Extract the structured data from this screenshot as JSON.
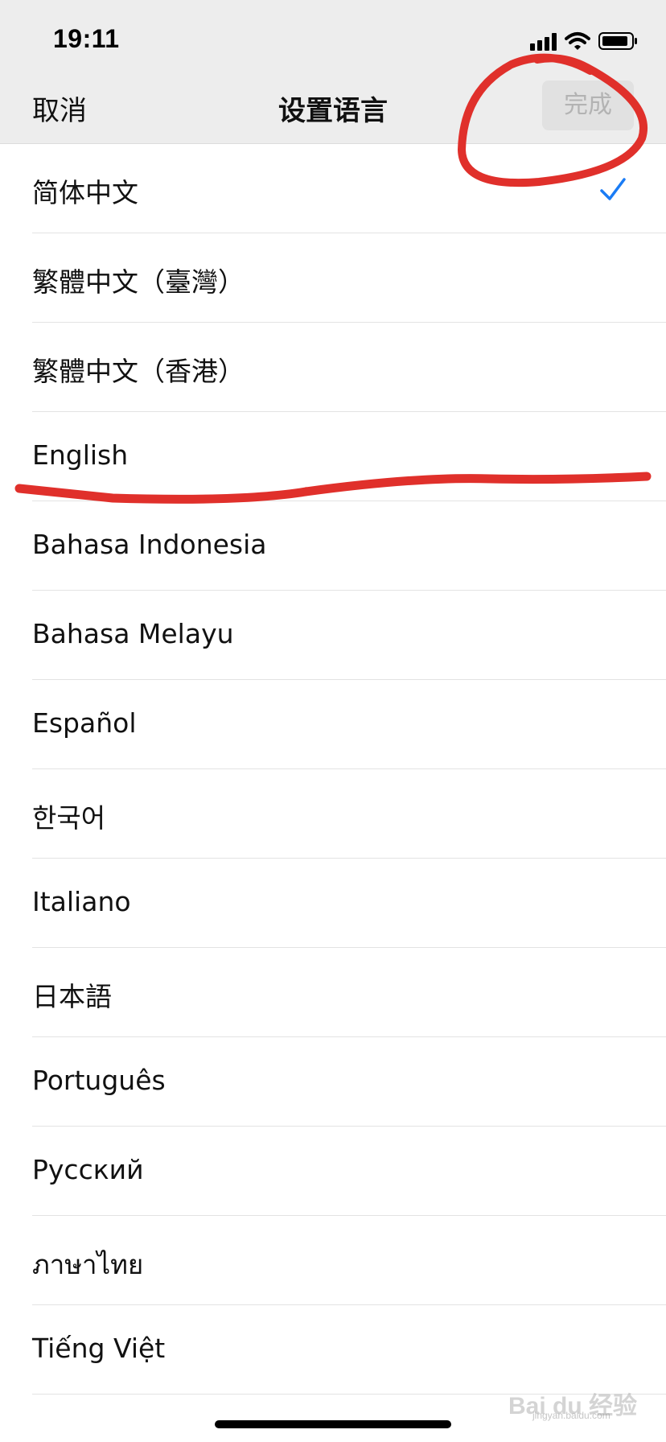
{
  "status_bar": {
    "time": "19:11",
    "icons": [
      "signal-icon",
      "wifi-icon",
      "battery-icon"
    ]
  },
  "nav": {
    "cancel_label": "取消",
    "title": "设置语言",
    "done_label": "完成",
    "done_enabled": false
  },
  "languages": [
    {
      "label": "简体中文",
      "selected": true
    },
    {
      "label": "繁體中文（臺灣）",
      "selected": false
    },
    {
      "label": "繁體中文（香港）",
      "selected": false
    },
    {
      "label": "English",
      "selected": false
    },
    {
      "label": "Bahasa Indonesia",
      "selected": false
    },
    {
      "label": "Bahasa Melayu",
      "selected": false
    },
    {
      "label": "Español",
      "selected": false
    },
    {
      "label": "한국어",
      "selected": false
    },
    {
      "label": "Italiano",
      "selected": false
    },
    {
      "label": "日本語",
      "selected": false
    },
    {
      "label": "Português",
      "selected": false
    },
    {
      "label": "Русский",
      "selected": false
    },
    {
      "label": "ภาษาไทย",
      "selected": false
    },
    {
      "label": "Tiếng Việt",
      "selected": false
    }
  ],
  "colors": {
    "accent": "#1a7cf5",
    "annotation": "#e0302b",
    "bar_background": "#ededed"
  },
  "watermark": {
    "main": "Bai du 经验",
    "sub": "jingyan.baidu.com"
  }
}
